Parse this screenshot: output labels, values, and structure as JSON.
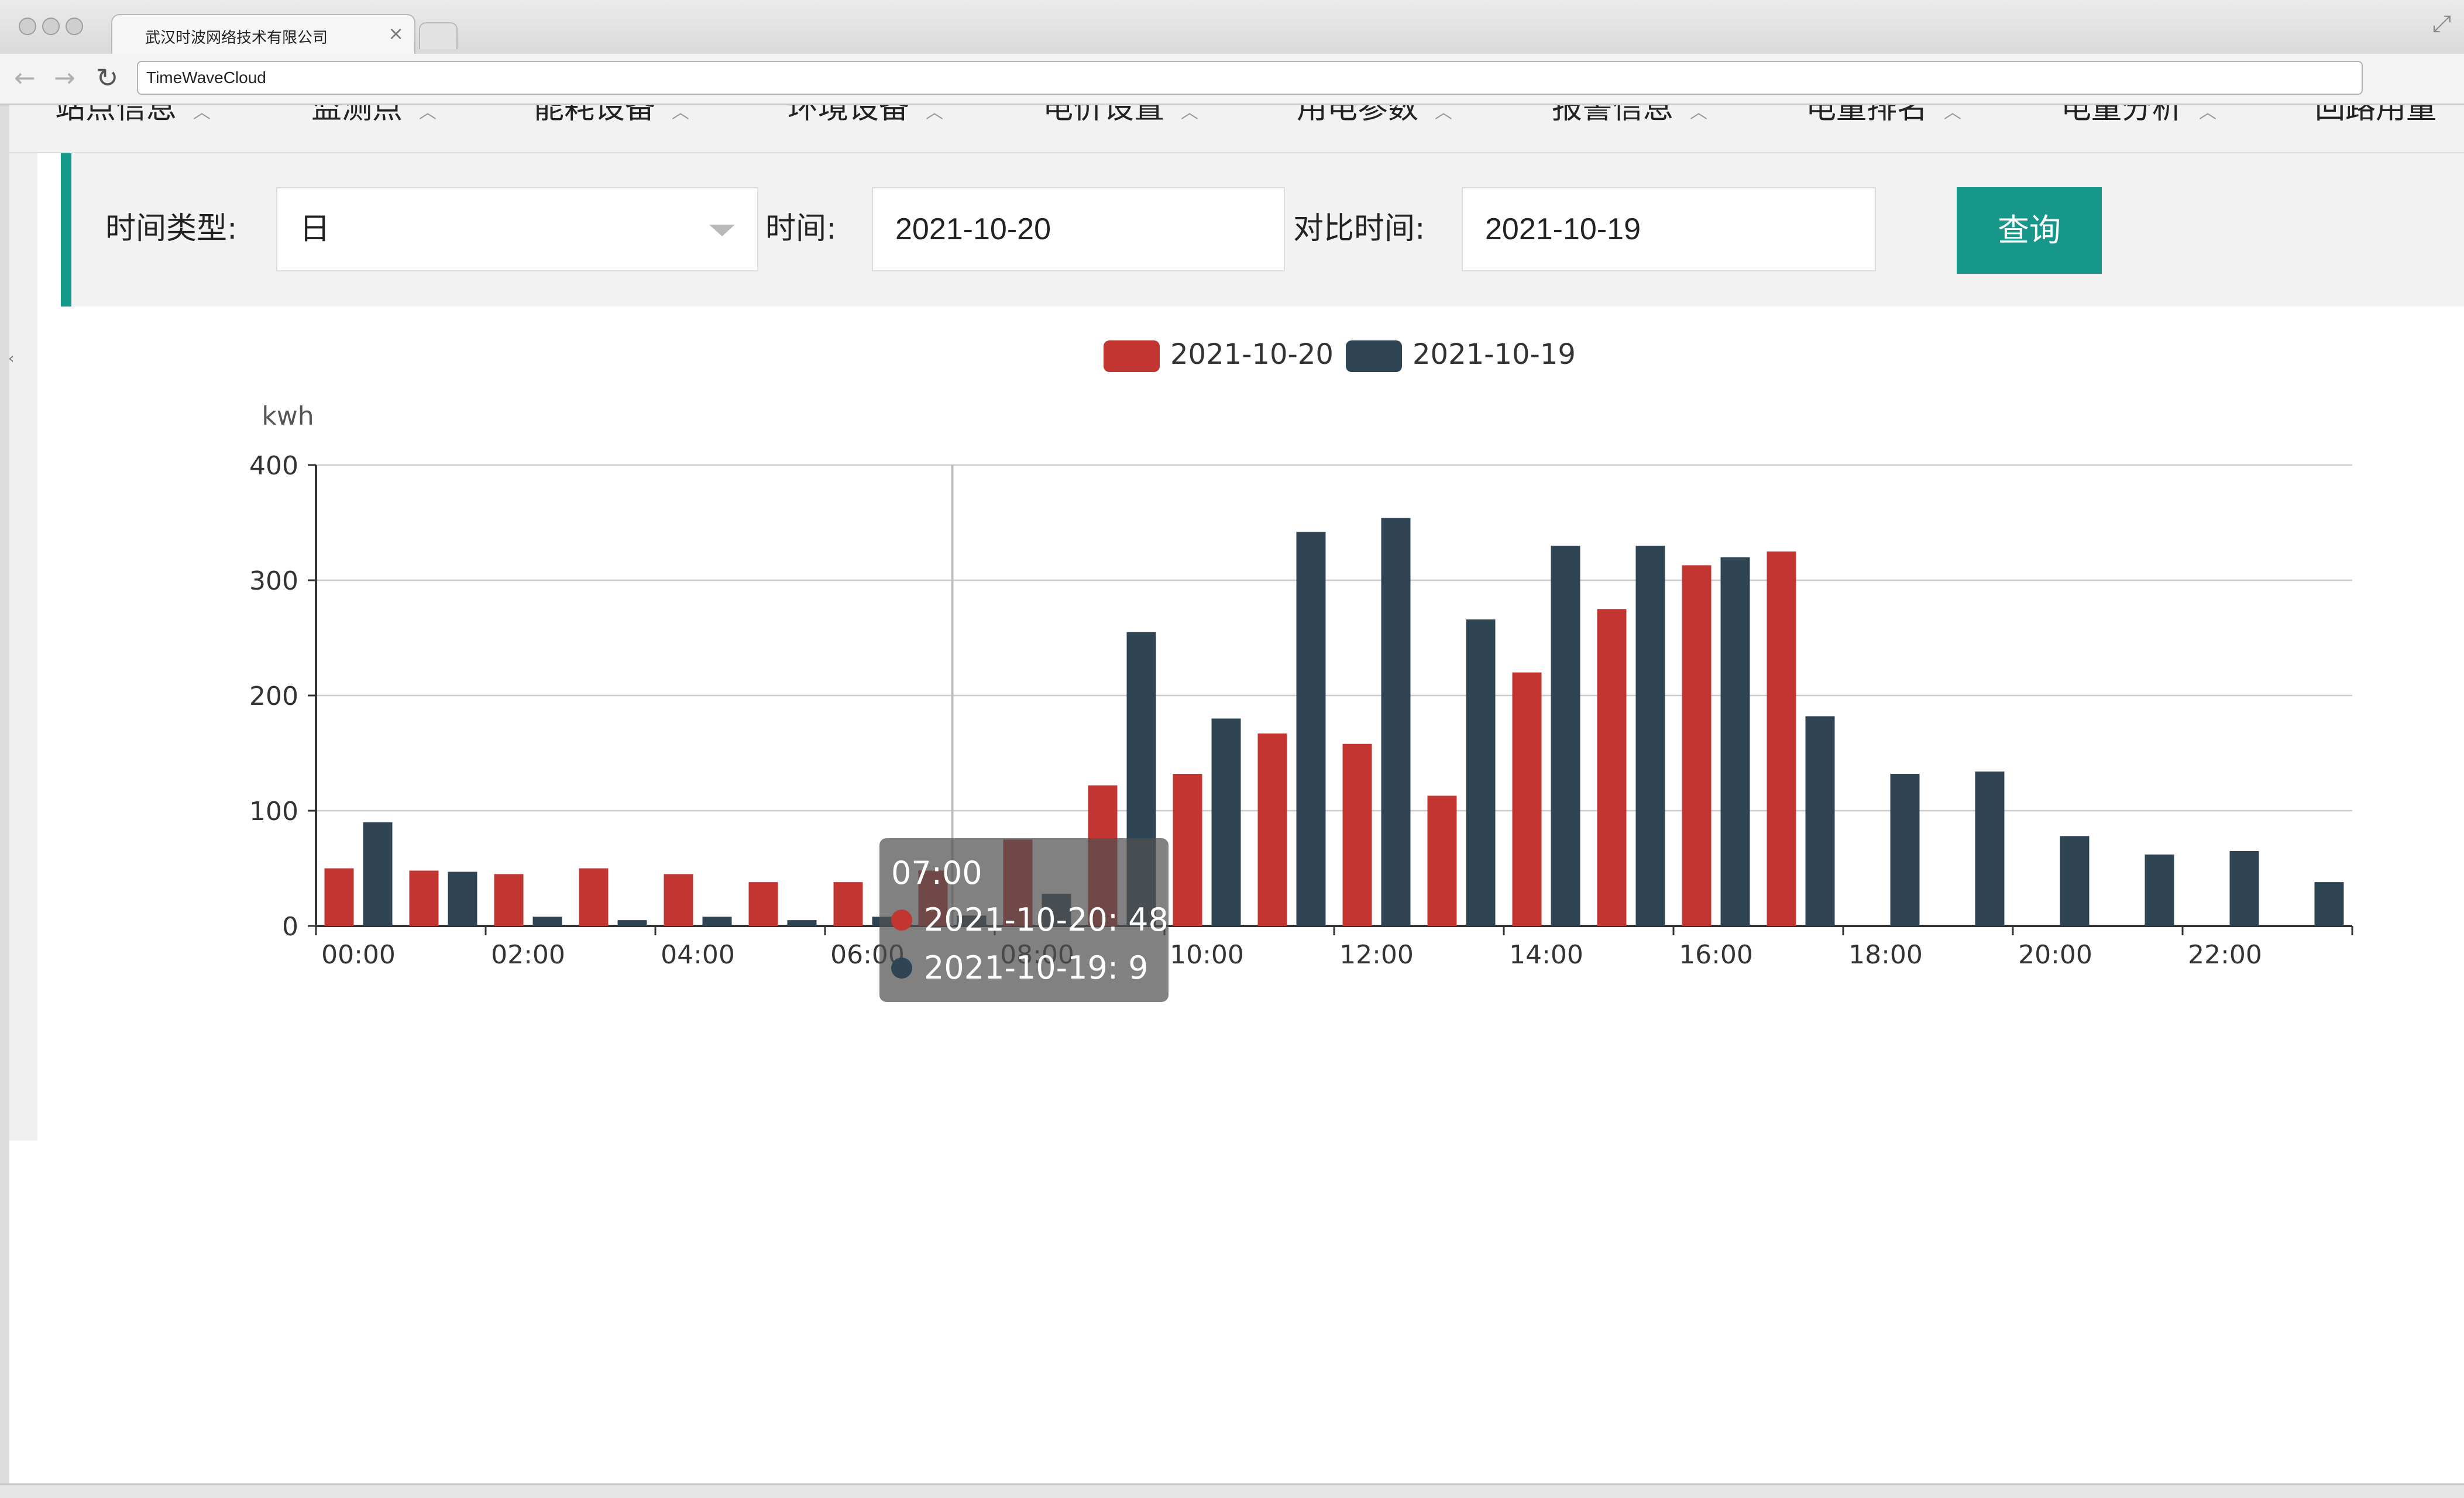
{
  "browser": {
    "tab_title": "武汉时波网络技术有限公司",
    "tab_close": "×",
    "address": "TimeWaveCloud",
    "back": "←",
    "forward": "→",
    "reload": "↻",
    "fullscreen": "⤢"
  },
  "menu": [
    {
      "label": "站点信息",
      "icon": "chevron-up-icon"
    },
    {
      "label": "监测点",
      "icon": "chevron-up-icon"
    },
    {
      "label": "能耗设备",
      "icon": "chevron-up-icon"
    },
    {
      "label": "环境设备",
      "icon": "chevron-up-icon"
    },
    {
      "label": "电价设置",
      "icon": "chevron-up-icon"
    },
    {
      "label": "用电参数",
      "icon": "chevron-up-icon"
    },
    {
      "label": "报警信息",
      "icon": "chevron-up-icon"
    },
    {
      "label": "电量排名",
      "icon": "chevron-up-icon"
    },
    {
      "label": "电量分析",
      "icon": "chevron-up-icon"
    },
    {
      "label": "回路用量",
      "icon": ""
    }
  ],
  "filters": {
    "time_type_label": "时间类型:",
    "time_type_value": "日",
    "time_label": "时间:",
    "time_value": "2021-10-20",
    "compare_label": "对比时间:",
    "compare_value": "2021-10-19",
    "query_button": "查询"
  },
  "colors": {
    "accent": "#159a8a",
    "series_current": "#c23531",
    "series_compare": "#2f4554"
  },
  "chart_data": {
    "type": "bar",
    "ylabel": "kwh",
    "ylim": [
      0,
      400
    ],
    "yticks": [
      "0",
      "100",
      "200",
      "300",
      "400"
    ],
    "xtick_labels": [
      "00:00",
      "02:00",
      "04:00",
      "06:00",
      "08:00",
      "10:00",
      "12:00",
      "14:00",
      "16:00",
      "18:00",
      "20:00",
      "22:00"
    ],
    "categories": [
      "00:00",
      "01:00",
      "02:00",
      "03:00",
      "04:00",
      "05:00",
      "06:00",
      "07:00",
      "08:00",
      "09:00",
      "10:00",
      "11:00",
      "12:00",
      "13:00",
      "14:00",
      "15:00",
      "16:00",
      "17:00",
      "18:00",
      "19:00",
      "20:00",
      "21:00",
      "22:00",
      "23:00"
    ],
    "grid": true,
    "legend_position": "top-center",
    "series": [
      {
        "name": "2021-10-20",
        "values": [
          50,
          48,
          45,
          50,
          45,
          38,
          38,
          48,
          75,
          122,
          132,
          167,
          158,
          113,
          220,
          275,
          313,
          325,
          null,
          null,
          null,
          null,
          null,
          null
        ]
      },
      {
        "name": "2021-10-19",
        "values": [
          90,
          47,
          8,
          5,
          8,
          5,
          8,
          9,
          28,
          255,
          180,
          342,
          354,
          266,
          330,
          330,
          320,
          182,
          132,
          134,
          78,
          62,
          65,
          38
        ]
      }
    ],
    "tooltip": {
      "title": "07:00",
      "lines": [
        "2021-10-20: 48",
        "2021-10-19: 9"
      ]
    }
  }
}
